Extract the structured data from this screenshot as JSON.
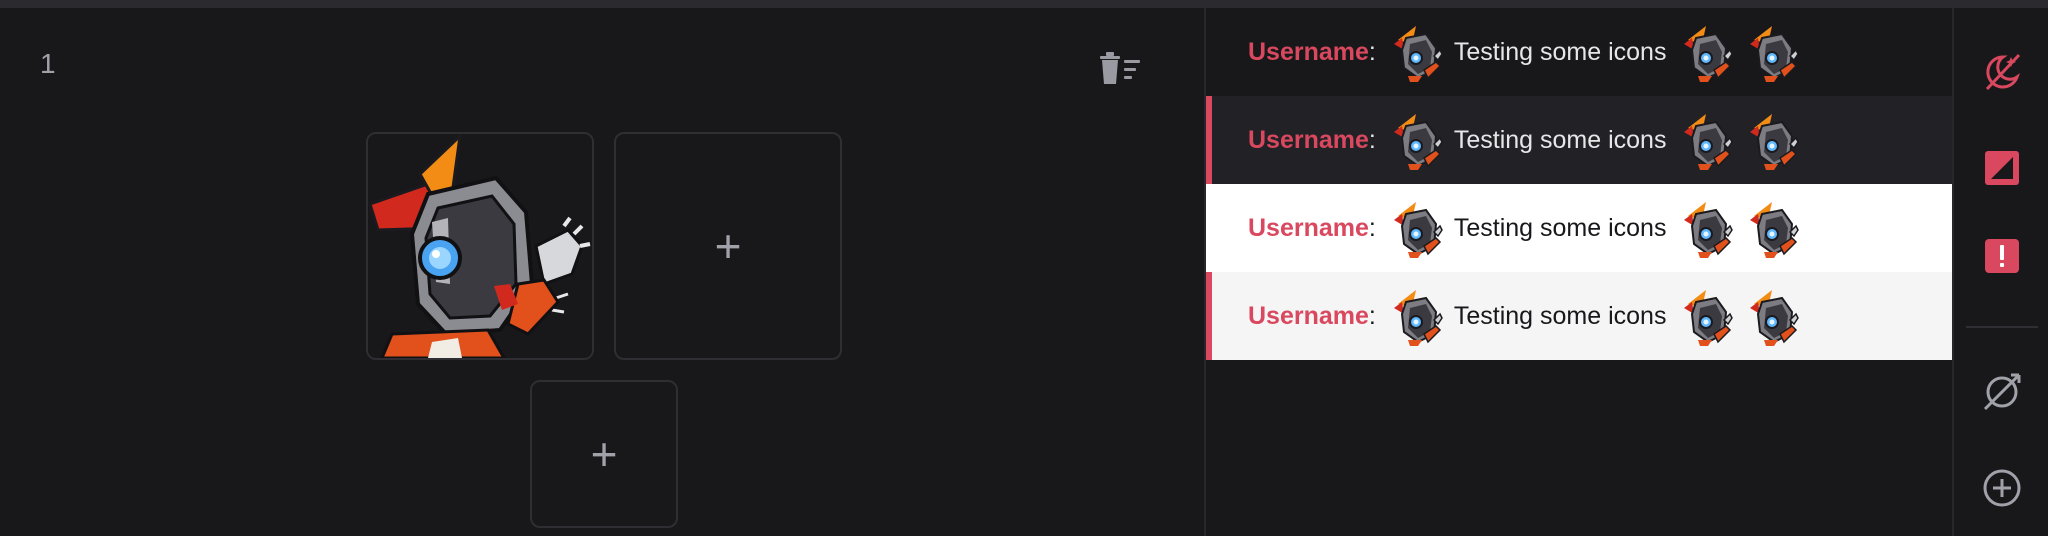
{
  "editor": {
    "slot_index": "1",
    "add_symbol": "+"
  },
  "preview": {
    "rows": [
      {
        "theme": "dark",
        "highlighted": false,
        "username": "Username",
        "separator": ":",
        "message": "Testing some icons"
      },
      {
        "theme": "dark",
        "highlighted": true,
        "username": "Username",
        "separator": ":",
        "message": "Testing some icons"
      },
      {
        "theme": "light",
        "highlighted": false,
        "username": "Username",
        "separator": ":",
        "message": "Testing some icons"
      },
      {
        "theme": "light",
        "highlighted": true,
        "username": "Username",
        "separator": ":",
        "message": "Testing some icons"
      }
    ]
  },
  "toolbar": {
    "icons": [
      "animation-off-icon",
      "theme-contrast-icon",
      "alert-icon",
      "visibility-off-icon",
      "add-circle-icon"
    ]
  },
  "colors": {
    "accent": "#d9485e",
    "background": "#18181b",
    "light_row": "#ffffff"
  }
}
